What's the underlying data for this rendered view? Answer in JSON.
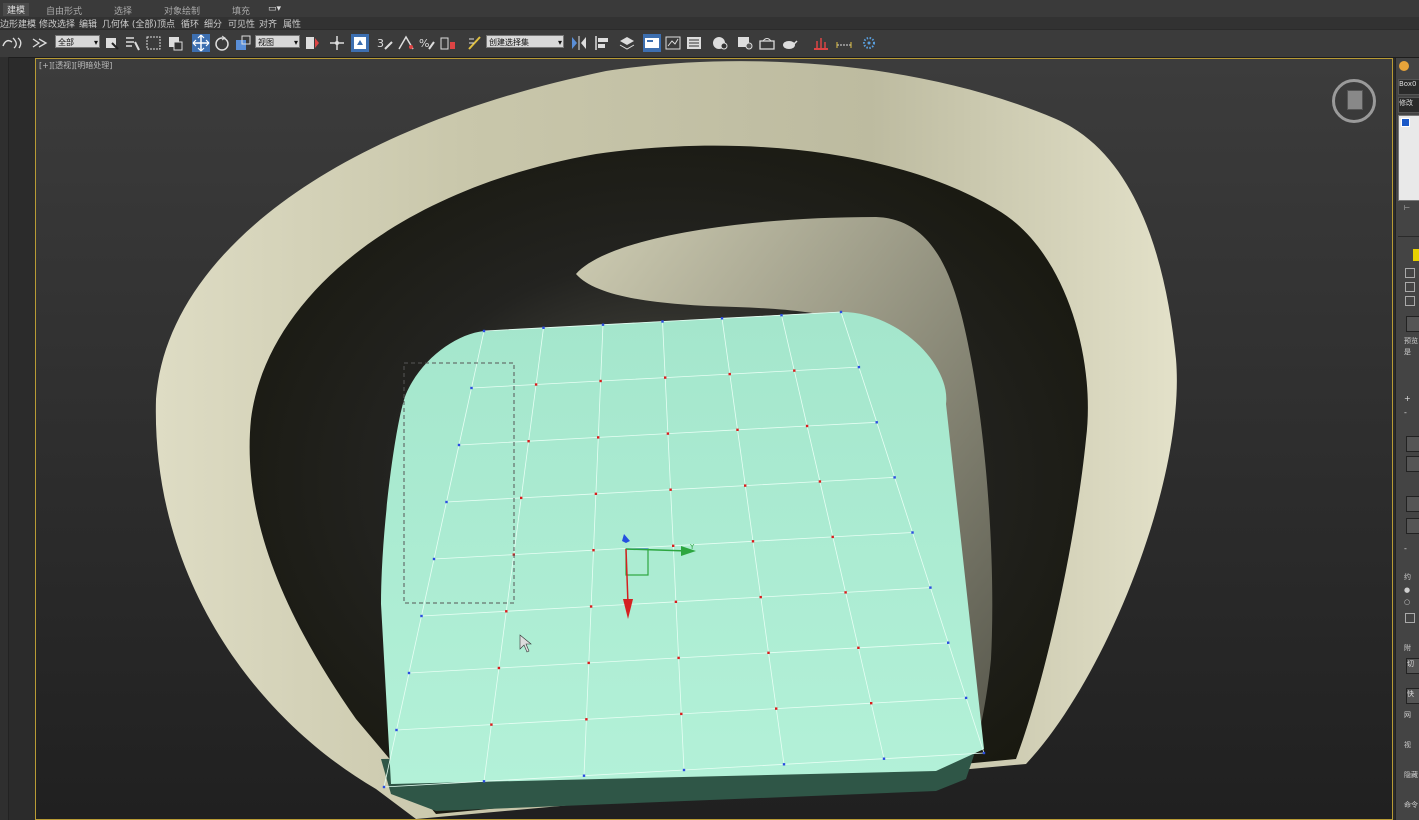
{
  "ribbon": {
    "tabs": [
      "建模",
      "自由形式",
      "选择",
      "对象绘制",
      "填充"
    ],
    "sub_items": [
      "边形建模",
      "修改选择",
      "编辑",
      "几何体 (全部)",
      "顶点",
      "循环",
      "细分",
      "可见性",
      "对齐",
      "属性"
    ]
  },
  "toolbar": {
    "selection_filter": "全部",
    "reference_coord": "视图",
    "named_selection_set": "创建选择集",
    "icons": [
      "undo-icon",
      "redo-icon",
      "bind-icon",
      "select-object-icon",
      "select-by-name-icon",
      "rect-selection-icon",
      "window-crossing-icon",
      "move-icon",
      "rotate-icon",
      "scale-icon",
      "pivot-icon",
      "manipulate-icon",
      "snap-toggle-icon",
      "angle-snap-icon",
      "percent-snap-icon",
      "spinner-snap-icon",
      "edit-named-sets-icon",
      "mirror-icon",
      "align-icon",
      "layer-manager-icon",
      "scene-explorer-icon",
      "graphite-icon",
      "curve-editor-icon",
      "schematic-icon",
      "material-editor-icon",
      "render-setup-icon",
      "render-frame-icon",
      "render-icon",
      "teapot-icon",
      "ruler-icon",
      "particle-icon"
    ]
  },
  "viewport": {
    "label": "[+][透视][明暗处理]",
    "axis_y": "Y"
  },
  "command_panel": {
    "object_name": "Box0",
    "modifier_list": "修改",
    "labels": [
      "预览",
      "是",
      "约",
      "附",
      "切",
      "快",
      "网",
      "视",
      "隐藏",
      "命令"
    ]
  }
}
